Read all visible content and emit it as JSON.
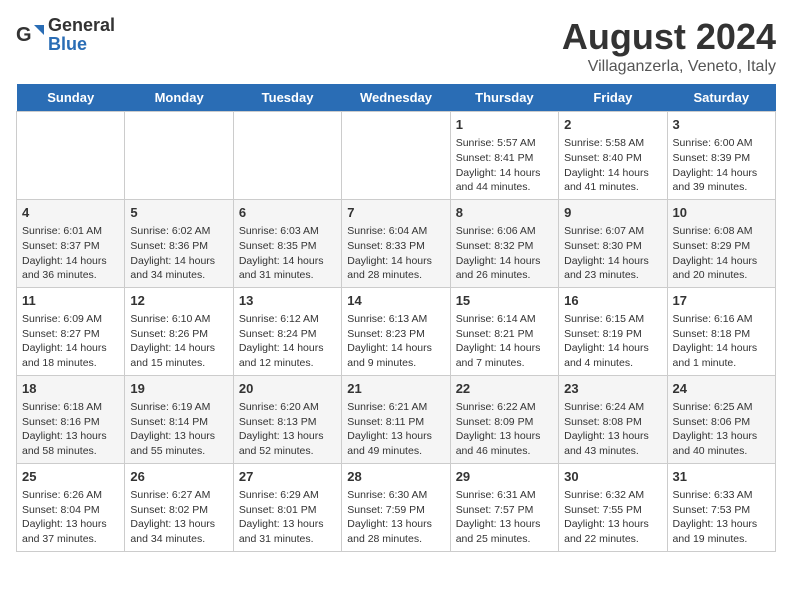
{
  "header": {
    "logo_general": "General",
    "logo_blue": "Blue",
    "title": "August 2024",
    "location": "Villaganzerla, Veneto, Italy"
  },
  "days_of_week": [
    "Sunday",
    "Monday",
    "Tuesday",
    "Wednesday",
    "Thursday",
    "Friday",
    "Saturday"
  ],
  "weeks": [
    [
      {
        "day": "",
        "content": ""
      },
      {
        "day": "",
        "content": ""
      },
      {
        "day": "",
        "content": ""
      },
      {
        "day": "",
        "content": ""
      },
      {
        "day": "1",
        "content": "Sunrise: 5:57 AM\nSunset: 8:41 PM\nDaylight: 14 hours and 44 minutes."
      },
      {
        "day": "2",
        "content": "Sunrise: 5:58 AM\nSunset: 8:40 PM\nDaylight: 14 hours and 41 minutes."
      },
      {
        "day": "3",
        "content": "Sunrise: 6:00 AM\nSunset: 8:39 PM\nDaylight: 14 hours and 39 minutes."
      }
    ],
    [
      {
        "day": "4",
        "content": "Sunrise: 6:01 AM\nSunset: 8:37 PM\nDaylight: 14 hours and 36 minutes."
      },
      {
        "day": "5",
        "content": "Sunrise: 6:02 AM\nSunset: 8:36 PM\nDaylight: 14 hours and 34 minutes."
      },
      {
        "day": "6",
        "content": "Sunrise: 6:03 AM\nSunset: 8:35 PM\nDaylight: 14 hours and 31 minutes."
      },
      {
        "day": "7",
        "content": "Sunrise: 6:04 AM\nSunset: 8:33 PM\nDaylight: 14 hours and 28 minutes."
      },
      {
        "day": "8",
        "content": "Sunrise: 6:06 AM\nSunset: 8:32 PM\nDaylight: 14 hours and 26 minutes."
      },
      {
        "day": "9",
        "content": "Sunrise: 6:07 AM\nSunset: 8:30 PM\nDaylight: 14 hours and 23 minutes."
      },
      {
        "day": "10",
        "content": "Sunrise: 6:08 AM\nSunset: 8:29 PM\nDaylight: 14 hours and 20 minutes."
      }
    ],
    [
      {
        "day": "11",
        "content": "Sunrise: 6:09 AM\nSunset: 8:27 PM\nDaylight: 14 hours and 18 minutes."
      },
      {
        "day": "12",
        "content": "Sunrise: 6:10 AM\nSunset: 8:26 PM\nDaylight: 14 hours and 15 minutes."
      },
      {
        "day": "13",
        "content": "Sunrise: 6:12 AM\nSunset: 8:24 PM\nDaylight: 14 hours and 12 minutes."
      },
      {
        "day": "14",
        "content": "Sunrise: 6:13 AM\nSunset: 8:23 PM\nDaylight: 14 hours and 9 minutes."
      },
      {
        "day": "15",
        "content": "Sunrise: 6:14 AM\nSunset: 8:21 PM\nDaylight: 14 hours and 7 minutes."
      },
      {
        "day": "16",
        "content": "Sunrise: 6:15 AM\nSunset: 8:19 PM\nDaylight: 14 hours and 4 minutes."
      },
      {
        "day": "17",
        "content": "Sunrise: 6:16 AM\nSunset: 8:18 PM\nDaylight: 14 hours and 1 minute."
      }
    ],
    [
      {
        "day": "18",
        "content": "Sunrise: 6:18 AM\nSunset: 8:16 PM\nDaylight: 13 hours and 58 minutes."
      },
      {
        "day": "19",
        "content": "Sunrise: 6:19 AM\nSunset: 8:14 PM\nDaylight: 13 hours and 55 minutes."
      },
      {
        "day": "20",
        "content": "Sunrise: 6:20 AM\nSunset: 8:13 PM\nDaylight: 13 hours and 52 minutes."
      },
      {
        "day": "21",
        "content": "Sunrise: 6:21 AM\nSunset: 8:11 PM\nDaylight: 13 hours and 49 minutes."
      },
      {
        "day": "22",
        "content": "Sunrise: 6:22 AM\nSunset: 8:09 PM\nDaylight: 13 hours and 46 minutes."
      },
      {
        "day": "23",
        "content": "Sunrise: 6:24 AM\nSunset: 8:08 PM\nDaylight: 13 hours and 43 minutes."
      },
      {
        "day": "24",
        "content": "Sunrise: 6:25 AM\nSunset: 8:06 PM\nDaylight: 13 hours and 40 minutes."
      }
    ],
    [
      {
        "day": "25",
        "content": "Sunrise: 6:26 AM\nSunset: 8:04 PM\nDaylight: 13 hours and 37 minutes."
      },
      {
        "day": "26",
        "content": "Sunrise: 6:27 AM\nSunset: 8:02 PM\nDaylight: 13 hours and 34 minutes."
      },
      {
        "day": "27",
        "content": "Sunrise: 6:29 AM\nSunset: 8:01 PM\nDaylight: 13 hours and 31 minutes."
      },
      {
        "day": "28",
        "content": "Sunrise: 6:30 AM\nSunset: 7:59 PM\nDaylight: 13 hours and 28 minutes."
      },
      {
        "day": "29",
        "content": "Sunrise: 6:31 AM\nSunset: 7:57 PM\nDaylight: 13 hours and 25 minutes."
      },
      {
        "day": "30",
        "content": "Sunrise: 6:32 AM\nSunset: 7:55 PM\nDaylight: 13 hours and 22 minutes."
      },
      {
        "day": "31",
        "content": "Sunrise: 6:33 AM\nSunset: 7:53 PM\nDaylight: 13 hours and 19 minutes."
      }
    ]
  ]
}
